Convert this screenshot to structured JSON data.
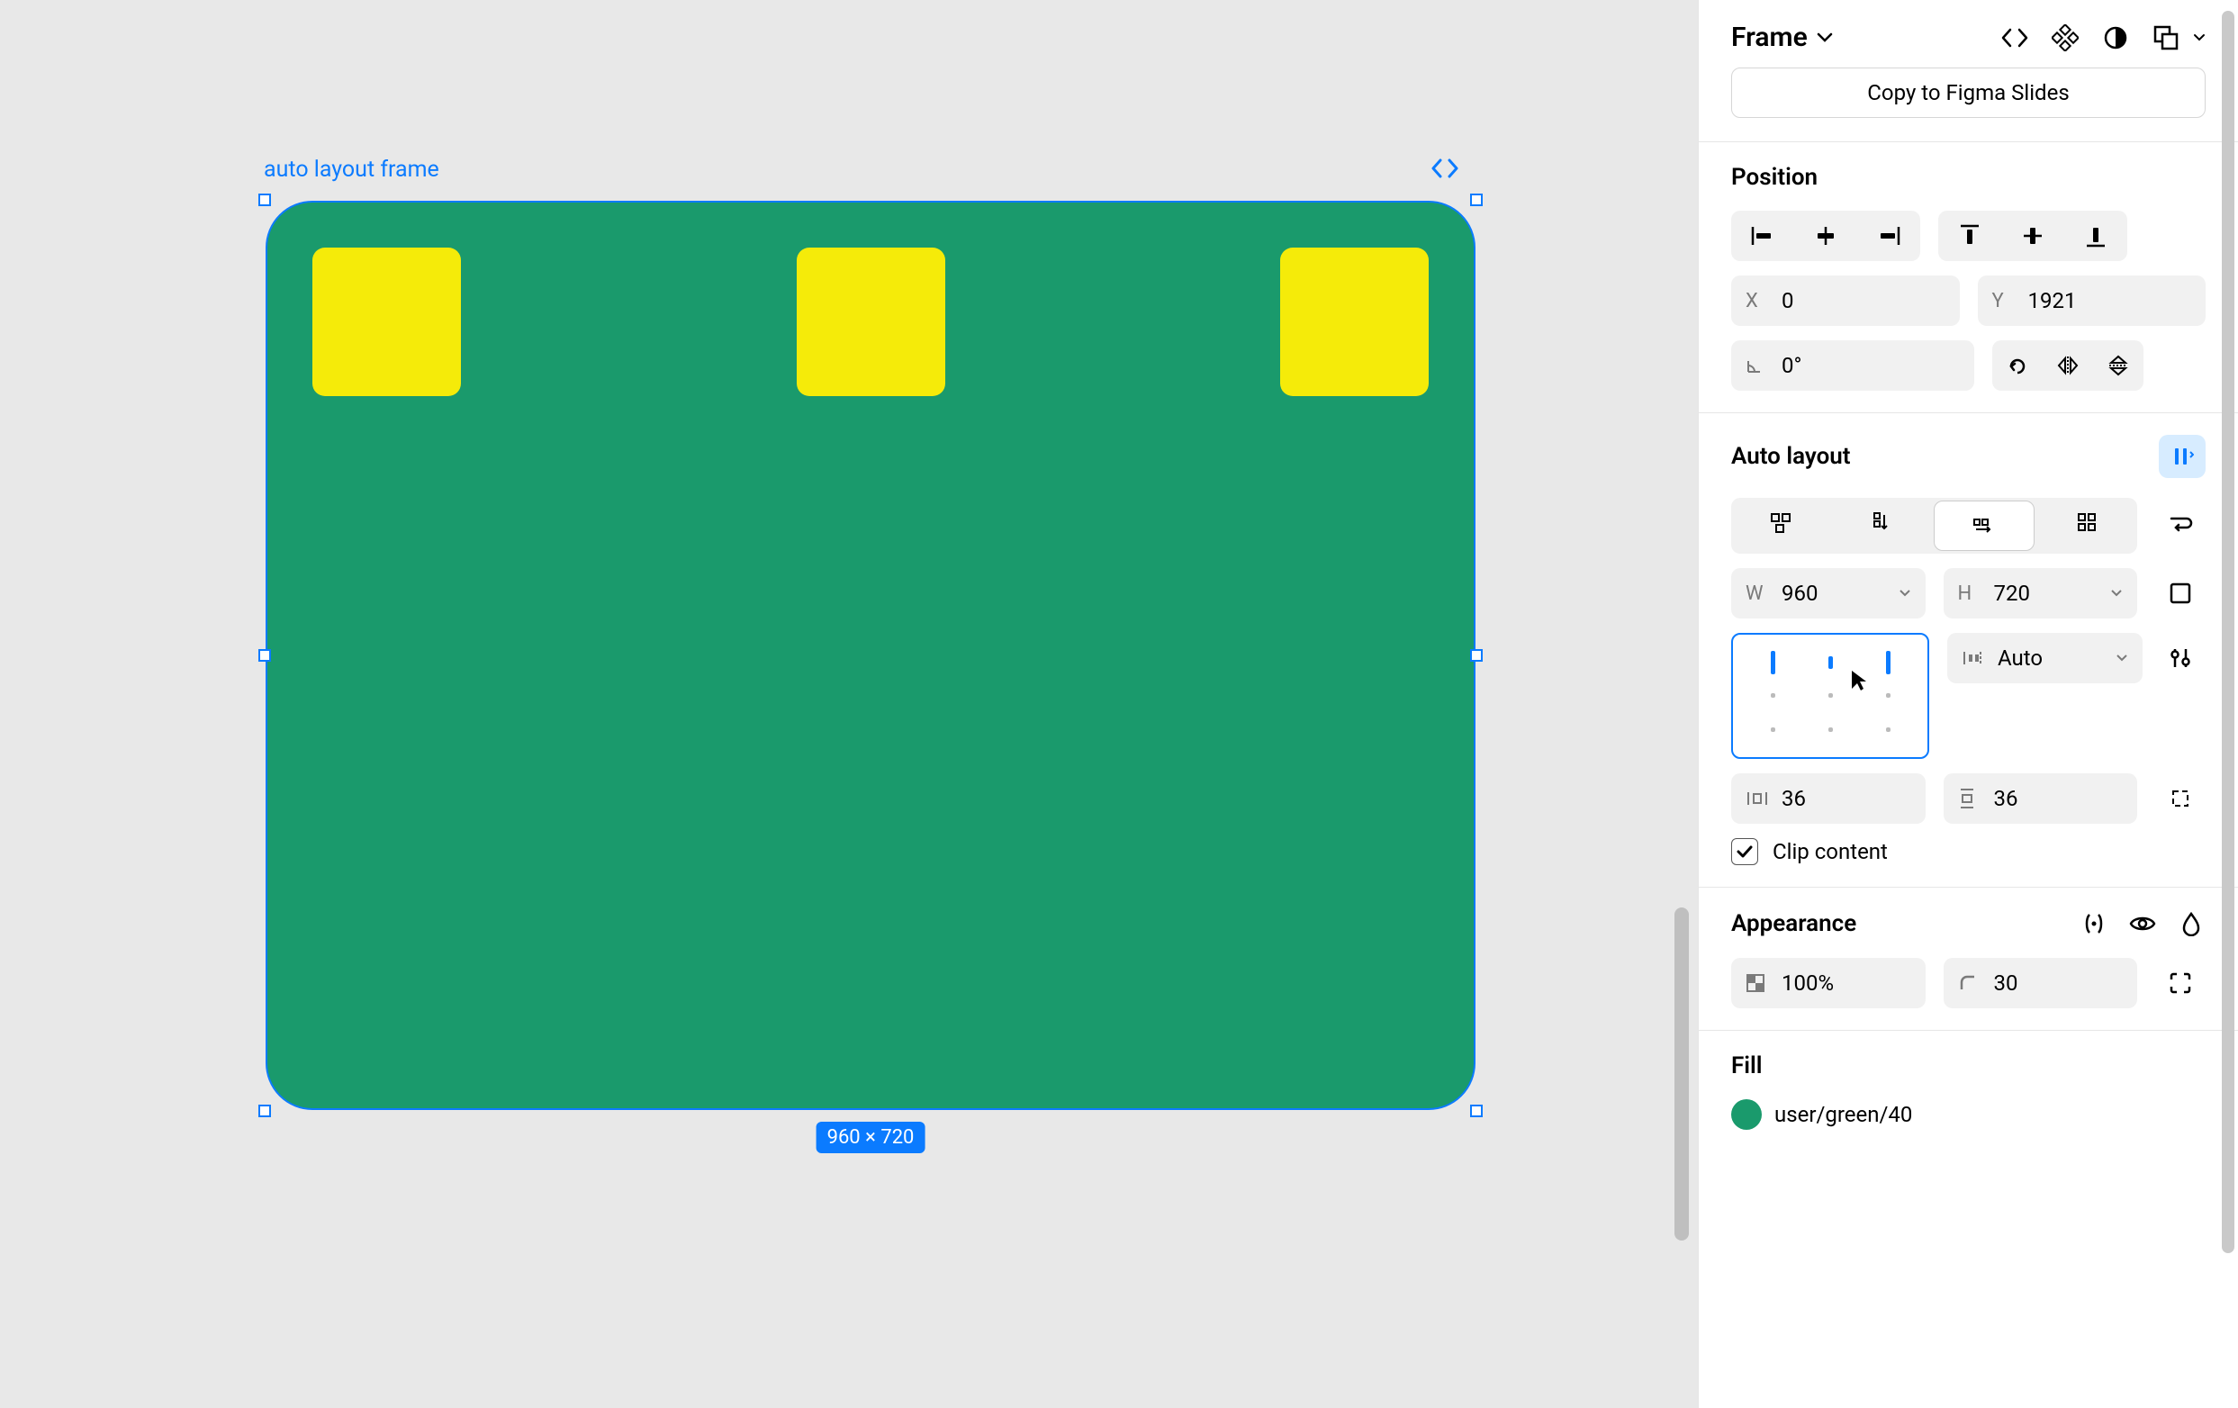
{
  "canvas": {
    "frame_label": "auto layout frame",
    "dimensions_badge": "960 × 720",
    "frame_bg": "#1a9a6c",
    "child_bg": "#f5eb09"
  },
  "header": {
    "title": "Frame",
    "copy_button": "Copy to Figma Slides"
  },
  "position": {
    "title": "Position",
    "x_label": "X",
    "x_value": "0",
    "y_label": "Y",
    "y_value": "1921",
    "rotation_value": "0°"
  },
  "autolayout": {
    "title": "Auto layout",
    "w_label": "W",
    "w_value": "960",
    "h_label": "H",
    "h_value": "720",
    "gap_value": "Auto",
    "pad_h": "36",
    "pad_v": "36",
    "clip_label": "Clip content",
    "clip_checked": true
  },
  "appearance": {
    "title": "Appearance",
    "opacity": "100%",
    "radius": "30"
  },
  "fill": {
    "title": "Fill",
    "color_name": "user/green/40",
    "swatch_hex": "#1a9a6c"
  }
}
